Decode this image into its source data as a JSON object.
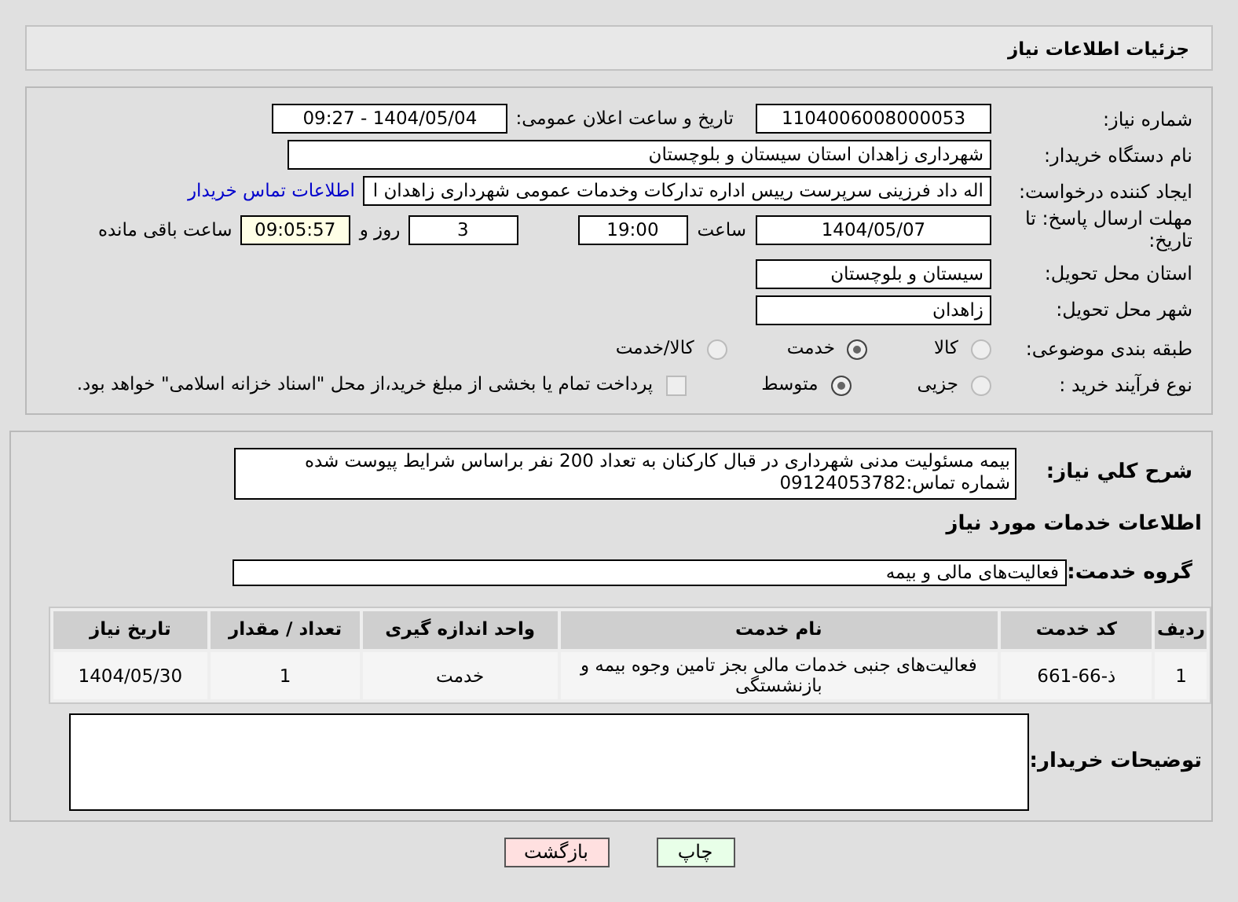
{
  "header": {
    "title": "جزئیات اطلاعات نیاز"
  },
  "details": {
    "need_number": {
      "label": "شماره نیاز:",
      "value": "1104006008000053"
    },
    "announce": {
      "label": "تاریخ و ساعت اعلان عمومی:",
      "value": "1404/05/04 - 09:27"
    },
    "buyer": {
      "label": "نام دستگاه خریدار:",
      "value": "شهرداری زاهدان استان سیستان و بلوچستان"
    },
    "creator": {
      "label": "ایجاد کننده درخواست:",
      "value": "اله داد فرزینی سرپرست رییس اداره تدارکات وخدمات عمومی شهرداری زاهدان ا",
      "link": "اطلاعات تماس خریدار"
    },
    "deadline": {
      "label": "مهلت ارسال پاسخ: تا تاریخ:",
      "date": "1404/05/07",
      "time_label": "ساعت",
      "time": "19:00",
      "days": "3",
      "days_label": "روز و",
      "remaining": "09:05:57",
      "remaining_label": "ساعت باقی مانده"
    },
    "province": {
      "label": "استان محل تحویل:",
      "value": "سیستان و بلوچستان"
    },
    "city": {
      "label": "شهر محل تحویل:",
      "value": "زاهدان"
    },
    "category": {
      "label": "طبقه بندی موضوعی:",
      "options": [
        {
          "label": "کالا",
          "selected": false
        },
        {
          "label": "خدمت",
          "selected": true
        },
        {
          "label": "کالا/خدمت",
          "selected": false
        }
      ]
    },
    "process": {
      "label": "نوع فرآیند خرید :",
      "options": [
        {
          "label": "جزیی",
          "selected": false
        },
        {
          "label": "متوسط",
          "selected": true
        }
      ],
      "payment": {
        "label": "پرداخت تمام یا بخشی از مبلغ خرید،از محل \"اسناد خزانه اسلامی\" خواهد بود.",
        "checked": false
      }
    }
  },
  "needs": {
    "description": {
      "label": "شرح کلي نياز:",
      "value": "بیمه مسئولیت مدنی شهرداری در قبال کارکنان به تعداد 200 نفر براساس شرایط پیوست شده\nشماره تماس:09124053782"
    },
    "services_title": "اطلاعات خدمات مورد نیاز",
    "group": {
      "label": "گروه خدمت:",
      "value": "فعالیت‌های مالی و بیمه"
    },
    "table": {
      "columns": [
        "ردیف",
        "کد خدمت",
        "نام خدمت",
        "واحد اندازه گیری",
        "تعداد / مقدار",
        "تاریخ نیاز"
      ],
      "rows": [
        [
          "1",
          "ذ-66-661",
          "فعالیت‌های جنبی خدمات مالی بجز تامین وجوه بیمه و بازنشستگی",
          "خدمت",
          "1",
          "1404/05/30"
        ]
      ]
    },
    "buyer_notes": {
      "label": "توضیحات خریدار:"
    }
  },
  "buttons": [
    {
      "label": "چاپ",
      "kind": "print"
    },
    {
      "label": "بازگشت",
      "kind": "back"
    }
  ]
}
